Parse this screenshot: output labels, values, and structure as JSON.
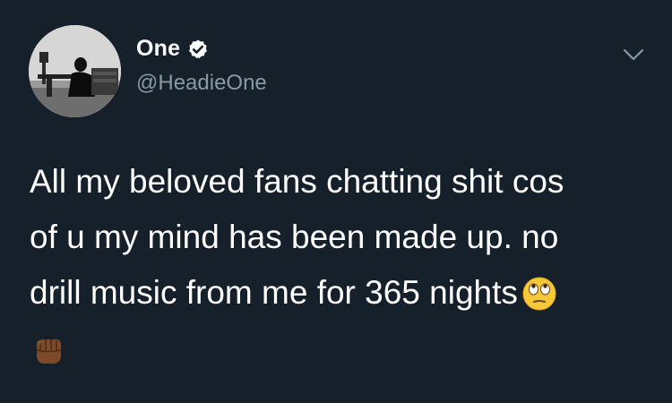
{
  "tweet": {
    "display_name": "One",
    "handle": "@HeadieOne",
    "text_lines": [
      "All my beloved fans chatting shit cos",
      "of u my mind has been made up. no",
      "drill music from me for 365 nights"
    ],
    "emojis": [
      "face-with-rolling-eyes-emoji",
      "oncoming-fist-dark-skin-emoji"
    ],
    "verified_icon": "verified-badge-icon",
    "menu_icon": "chevron-down-icon"
  },
  "theme": {
    "background": "#15202b",
    "text": "#ffffff",
    "secondary_text": "#8899a6"
  }
}
